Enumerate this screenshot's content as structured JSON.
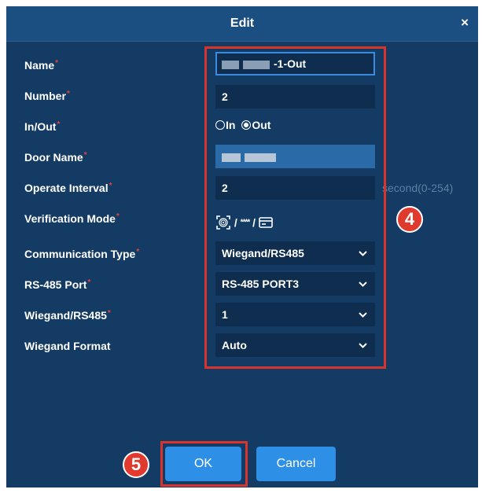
{
  "dialog": {
    "title": "Edit",
    "close_label": "×"
  },
  "form": {
    "required_mark": "*",
    "name": {
      "label": "Name",
      "value": "-1-Out"
    },
    "number": {
      "label": "Number",
      "value": "2"
    },
    "in_out": {
      "label": "In/Out",
      "options": [
        "In",
        "Out"
      ],
      "selected": "Out"
    },
    "door_name": {
      "label": "Door Name"
    },
    "operate_interval": {
      "label": "Operate Interval",
      "value": "2",
      "hint": "second(0-254)"
    },
    "verification_mode": {
      "label": "Verification Mode",
      "separator": "/",
      "icons": [
        "fingerprint-icon",
        "password-icon",
        "card-icon"
      ],
      "password_glyph": "****"
    },
    "communication_type": {
      "label": "Communication Type",
      "value": "Wiegand/RS485"
    },
    "rs485_port": {
      "label": "RS-485 Port",
      "value": "RS-485 PORT3"
    },
    "wiegand_rs485": {
      "label": "Wiegand/RS485",
      "value": "1"
    },
    "wiegand_format": {
      "label": "Wiegand Format",
      "value": "Auto"
    }
  },
  "buttons": {
    "ok_label": "OK",
    "cancel_label": "Cancel"
  },
  "annotations": {
    "step_4": "4",
    "step_5": "5"
  },
  "colors": {
    "dialog_bg": "#133b64",
    "accent": "#2e8fe6",
    "annotation_red": "#d9342b"
  }
}
